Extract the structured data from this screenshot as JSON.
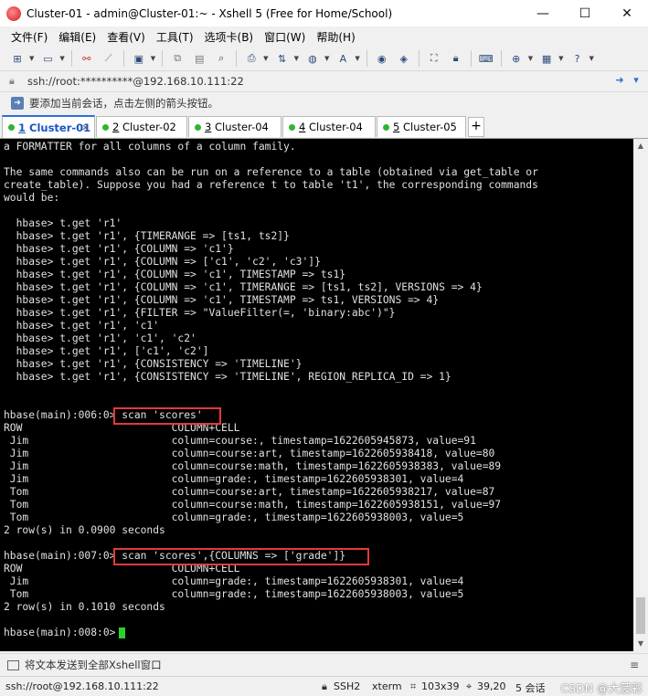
{
  "window": {
    "title": "Cluster-01 - admin@Cluster-01:~ - Xshell 5 (Free for Home/School)",
    "minimize": "—",
    "maximize": "☐",
    "close": "✕"
  },
  "menu": [
    "文件(F)",
    "编辑(E)",
    "查看(V)",
    "工具(T)",
    "选项卡(B)",
    "窗口(W)",
    "帮助(H)"
  ],
  "address": {
    "value": "ssh://root:**********@192.168.10.111:22"
  },
  "hint": "要添加当前会话，点击左侧的箭头按钮。",
  "tabs": [
    {
      "num": "1",
      "name": " Cluster-01",
      "active": true
    },
    {
      "num": "2",
      "name": " Cluster-02",
      "active": false
    },
    {
      "num": "3",
      "name": " Cluster-04",
      "active": false
    },
    {
      "num": "4",
      "name": " Cluster-04",
      "active": false
    },
    {
      "num": "5",
      "name": " Cluster-05",
      "active": false
    }
  ],
  "terminal": {
    "lines": [
      "a FORMATTER for all columns of a column family.",
      "",
      "The same commands also can be run on a reference to a table (obtained via get_table or",
      "create_table). Suppose you had a reference t to table 't1', the corresponding commands",
      "would be:",
      "",
      "  hbase> t.get 'r1'",
      "  hbase> t.get 'r1', {TIMERANGE => [ts1, ts2]}",
      "  hbase> t.get 'r1', {COLUMN => 'c1'}",
      "  hbase> t.get 'r1', {COLUMN => ['c1', 'c2', 'c3']}",
      "  hbase> t.get 'r1', {COLUMN => 'c1', TIMESTAMP => ts1}",
      "  hbase> t.get 'r1', {COLUMN => 'c1', TIMERANGE => [ts1, ts2], VERSIONS => 4}",
      "  hbase> t.get 'r1', {COLUMN => 'c1', TIMESTAMP => ts1, VERSIONS => 4}",
      "  hbase> t.get 'r1', {FILTER => \"ValueFilter(=, 'binary:abc')\"}",
      "  hbase> t.get 'r1', 'c1'",
      "  hbase> t.get 'r1', 'c1', 'c2'",
      "  hbase> t.get 'r1', ['c1', 'c2']",
      "  hbase> t.get 'r1', {CONSISTENCY => 'TIMELINE'}",
      "  hbase> t.get 'r1', {CONSISTENCY => 'TIMELINE', REGION_REPLICA_ID => 1}",
      "",
      "",
      "hbase(main):006:0> scan 'scores'",
      "ROW                        COLUMN+CELL",
      " Jim                       column=course:, timestamp=1622605945873, value=91",
      " Jim                       column=course:art, timestamp=1622605938418, value=80",
      " Jim                       column=course:math, timestamp=1622605938383, value=89",
      " Jim                       column=grade:, timestamp=1622605938301, value=4",
      " Tom                       column=course:art, timestamp=1622605938217, value=87",
      " Tom                       column=course:math, timestamp=1622605938151, value=97",
      " Tom                       column=grade:, timestamp=1622605938003, value=5",
      "2 row(s) in 0.0900 seconds",
      "",
      "hbase(main):007:0> scan 'scores',{COLUMNS => ['grade']}",
      "ROW                        COLUMN+CELL",
      " Jim                       column=grade:, timestamp=1622605938301, value=4",
      " Tom                       column=grade:, timestamp=1622605938003, value=5",
      "2 row(s) in 0.1010 seconds",
      "",
      "hbase(main):008:0> "
    ]
  },
  "sendbar": {
    "text": "将文本发送到全部Xshell窗口",
    "menu": "≡"
  },
  "status": {
    "connection": "ssh://root@192.168.10.111:22",
    "protocol": "SSH2",
    "terminal": "xterm",
    "size": "103x39",
    "position": "39,20",
    "sessions": "5 会话",
    "watermark": "CSDN @大菠彩"
  },
  "colors": {
    "highlight_box": "#e23a3a",
    "cursor": "#2bd12b",
    "active_tab": "#1a56c4"
  }
}
